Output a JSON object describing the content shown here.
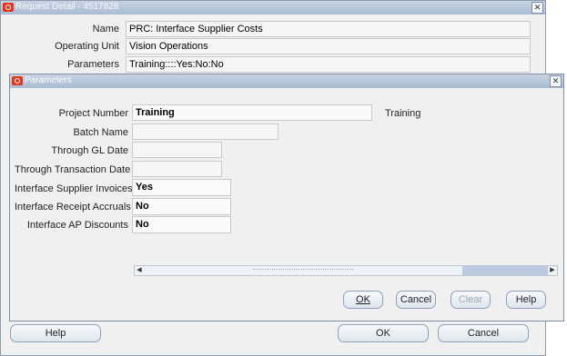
{
  "request_window": {
    "title": "Request Detail - 4517828",
    "fields": [
      {
        "label": "Name",
        "value": "PRC: Interface Supplier Costs"
      },
      {
        "label": "Operating Unit",
        "value": "Vision Operations"
      },
      {
        "label": "Parameters",
        "value": "Training::::Yes:No:No"
      }
    ],
    "buttons": {
      "help": "Help",
      "ok": "OK",
      "cancel": "Cancel"
    }
  },
  "params_window": {
    "title": "Parameters",
    "fields": [
      {
        "label": "Project Number",
        "value": "Training",
        "desc": "Training"
      },
      {
        "label": "Batch Name",
        "value": ""
      },
      {
        "label": "Through GL Date",
        "value": ""
      },
      {
        "label": "Through Transaction Date",
        "value": ""
      },
      {
        "label": "Interface Supplier Invoices",
        "value": "Yes"
      },
      {
        "label": "Interface Receipt Accruals",
        "value": "No"
      },
      {
        "label": "Interface AP Discounts",
        "value": "No"
      }
    ],
    "buttons": {
      "ok": "OK",
      "cancel": "Cancel",
      "clear": "Clear",
      "help": "Help"
    }
  },
  "icons": {
    "close": "close-icon",
    "oracle": "oracle-logo-icon",
    "scroll_left": "scroll-left-icon",
    "scroll_right": "scroll-right-icon"
  }
}
